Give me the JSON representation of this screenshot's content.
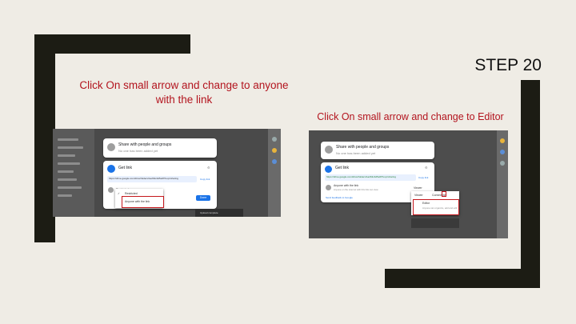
{
  "slide": {
    "step_title": "STEP 20",
    "caption_left": "Click On small arrow and change to anyone with the link",
    "caption_right": "Click On small arrow and change to Editor"
  },
  "left_screenshot": {
    "share_card_title": "Share with people and groups",
    "share_card_sub": "No one has been added yet",
    "get_link_title": "Get link",
    "link_url": "https://drive.google.com/drive/folders/1a2b3c4d5e6f?usp=sharing",
    "copy_link": "Copy link",
    "access_selected": "Restricted",
    "option_restricted": "Restricted",
    "option_anyone": "Anyone with the link",
    "done_button": "Done",
    "snackbar_text": "Upload complete"
  },
  "right_screenshot": {
    "share_card_title": "Share with people and groups",
    "share_card_sub": "No one has been added yet",
    "get_link_title": "Get link",
    "link_url": "https://drive.google.com/drive/folders/1a2b3c4d5e6f?usp=sharing",
    "copy_link": "Copy link",
    "anyone_title": "Anyone with the link",
    "anyone_sub": "Anyone on the internet with this link can view",
    "role_selected": "Viewer",
    "role_viewer": "Viewer",
    "role_commenter": "Commenter",
    "role_editor": "Editor",
    "role_editor_sub": "Anyone can organize, add and edit",
    "feedback_link": "Send feedback to Google"
  },
  "colors": {
    "background": "#efece5",
    "frame": "#1c1c14",
    "caption_red": "#b3141e",
    "highlight_red": "#c4161c",
    "google_blue": "#1a73e8"
  }
}
